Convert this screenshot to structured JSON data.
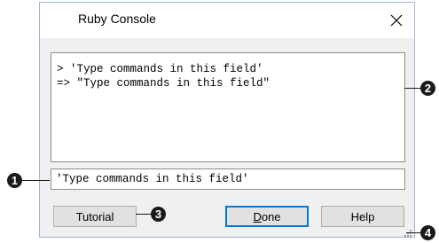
{
  "window": {
    "title": "Ruby Console",
    "close_icon": "close-icon"
  },
  "console": {
    "output_lines": "> 'Type commands in this field'\n=> \"Type commands in this field\"",
    "input_value": "'Type commands in this field'"
  },
  "buttons": {
    "tutorial_label": "Tutorial",
    "done_label_pre": "",
    "done_label_accel": "D",
    "done_label_post": "one",
    "help_label": "Help"
  },
  "callouts": {
    "one": "1",
    "two": "2",
    "three": "3",
    "four": "4"
  },
  "colors": {
    "dialog_border": "#9bb8d6",
    "default_button_border": "#0078d7",
    "callout_fill": "#1a1a1a"
  }
}
